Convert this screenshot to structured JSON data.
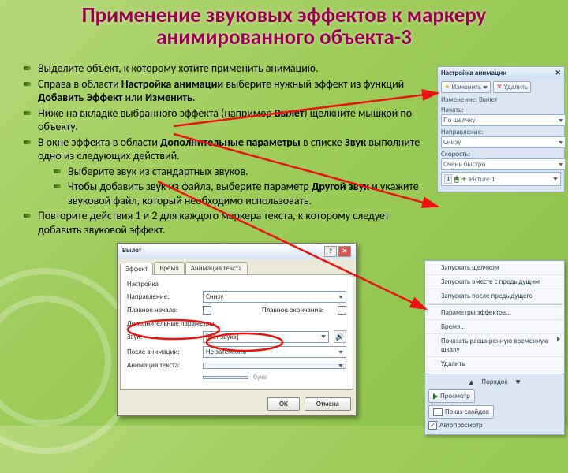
{
  "title": "Применение звуковых эффектов к маркеру анимированного объекта-3",
  "bullets": {
    "b1": "Выделите объект, к которому хотите применить анимацию.",
    "b2a": "Справа в области ",
    "b2b": "Настройка анимации",
    "b2c": " выберите нужный эффект  из  функций ",
    "b2d": "Добавить Эффект",
    "b2e": " или ",
    "b2f": "Изменить",
    "b2g": ".",
    "b3a": "Ниже  на вкладке выбранного эффекта (например ",
    "b3b": "Вылет",
    "b3c": ") щелкните мышкой по объекту.",
    "b4a": "В окне эффекта в области ",
    "b4b": "Дополнительные параметры",
    "b4c": " в списке ",
    "b4d": "Звук",
    "b4e": " выполните одно из следующих действий.",
    "s1": "Выберите звук из стандартных звуков.",
    "s2a": "Чтобы добавить звук из файла, выберите параметр ",
    "s2b": "Другой звук",
    "s2c": " и укажите звуковой файл, который необходимо использовать.",
    "b5": "Повторите действия 1 и 2 для каждого маркера текста, к которому следует добавить звуковой эффект."
  },
  "pane": {
    "title": "Настройка анимации",
    "change": "Изменить",
    "remove": "Удалить",
    "change_lbl": "Изменение: Вылет",
    "start_lbl": "Начать:",
    "start_val": "По щелчку",
    "dir_lbl": "Направление:",
    "dir_val": "Снизу",
    "speed_lbl": "Скорость:",
    "speed_val": "Очень быстро",
    "item_num": "1",
    "item_name": "Picture 1"
  },
  "ctx": {
    "i1": "Запускать щелчком",
    "i2": "Запускать вместе с предыдущим",
    "i3": "Запускать после предыдущего",
    "i4": "Параметры эффектов...",
    "i5": "Время...",
    "i6": "Показать расширенную временную шкалу",
    "i7": "Удалить",
    "order": "Порядок",
    "play": "Просмотр",
    "slideshow": "Показ слайдов",
    "autopreview": "Автопросмотр"
  },
  "dlg": {
    "title": "Вылет",
    "tab1": "Эффект",
    "tab2": "Время",
    "tab3": "Анимация текста",
    "grp1": "Настройка",
    "dir_lbl": "Направление:",
    "dir_val": "Снизу",
    "accel_lbl": "Плавное начало:",
    "decel_lbl": "Плавное окончание:",
    "grp2": "Дополнительные параметры",
    "sound_lbl": "Звук:",
    "sound_val": "[Нет звука]",
    "after_lbl": "После анимации:",
    "after_val": "Не затемнять",
    "text_lbl": "Анимация текста:",
    "text_val": "",
    "text_sp": "букв",
    "ok": "ОК",
    "cancel": "Отмена"
  }
}
